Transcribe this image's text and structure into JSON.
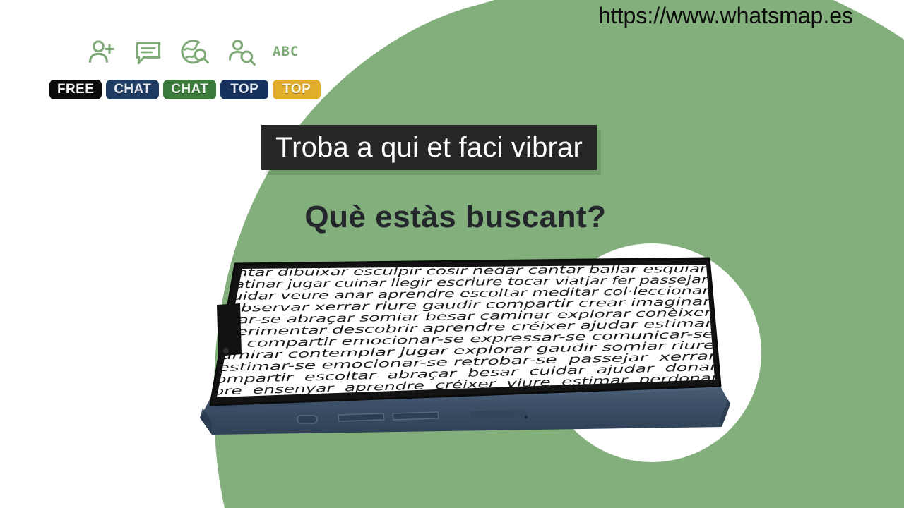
{
  "site": {
    "url": "https://www.whatsmap.es"
  },
  "colors": {
    "background": "#ffffff",
    "green": "#82af7b",
    "banner_dark": "#272727",
    "heading_dark": "#23262a",
    "icon_green": "#7faa77",
    "phone_body": "#3e5166",
    "phone_bezel": "#111111"
  },
  "icons": [
    {
      "name": "person-add-icon",
      "label": "Afegir persona"
    },
    {
      "name": "chat-bubble-icon",
      "label": "Xat"
    },
    {
      "name": "globe-search-icon",
      "label": "Cerca global"
    },
    {
      "name": "person-search-icon",
      "label": "Cerca persona"
    }
  ],
  "abc_mark": "ABC",
  "badges": [
    {
      "name": "badge-free",
      "label": "FREE",
      "bg": "#0b0b0b",
      "text": "#f2f2f2"
    },
    {
      "name": "badge-chat-blue",
      "label": "CHAT",
      "bg": "#1f3c63",
      "text": "#e6eaf2"
    },
    {
      "name": "badge-chat-green",
      "label": "CHAT",
      "bg": "#3b7a3b",
      "text": "#eaf3ea"
    },
    {
      "name": "badge-top-blue",
      "label": "TOP",
      "bg": "#16315c",
      "text": "#e2e8f3"
    },
    {
      "name": "badge-top-gold",
      "label": "TOP",
      "bg": "#e0ae2b",
      "text": "#fdf6e4"
    }
  ],
  "hero": {
    "headline": "Troba a qui et faci vibrar",
    "subheadline": "Què estàs buscant?"
  },
  "phone": {
    "screen_lines": [
      "ntar dibuixar esculpir cosir nedar cantar ballar esquiar",
      "atinar jugar cuinar llegir escriure tocar viatjar fer passejar",
      "uidar veure anar aprendre escoltar meditar col·leccionar",
      "observar xerrar riure gaudir compartir crear imaginar",
      "xar-se abraçar somiar besar caminar explorar conèixer",
      "perimentar descobrir aprendre créixer ajudar estimar",
      "re compartir emocionar-se expressar-se comunicar-se",
      "dmirar contemplar jugar explorar gaudir somiar riure",
      "estimar-se emocionar-se retrobar-se  passejar  xerrar",
      "ompartir  escoltar  abraçar  besar  cuidar  ajudar  donar",
      "bre  ensenyar  aprendre  créixer  viure  estimar  perdonar"
    ]
  }
}
